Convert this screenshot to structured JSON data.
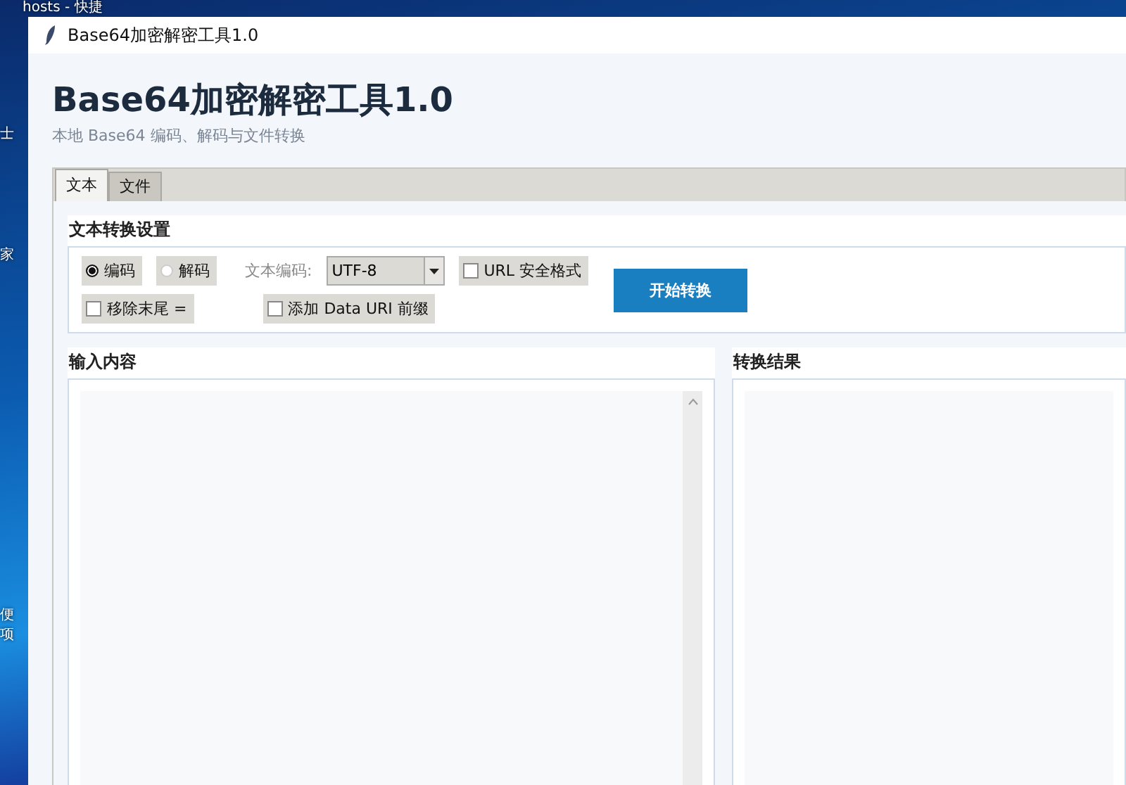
{
  "desktop": {
    "labels": [
      "hosts - 快捷",
      "士",
      "家",
      "便",
      "项"
    ]
  },
  "window": {
    "title": "Base64加密解密工具1.0"
  },
  "header": {
    "title": "Base64加密解密工具1.0",
    "subtitle": "本地 Base64 编码、解码与文件转换"
  },
  "tabs": [
    {
      "label": "文本",
      "selected": true
    },
    {
      "label": "文件",
      "selected": false
    }
  ],
  "settings": {
    "title": "文本转换设置",
    "modes": [
      {
        "label": "编码",
        "selected": true
      },
      {
        "label": "解码",
        "selected": false
      }
    ],
    "encoding_label": "文本编码:",
    "encoding": "UTF-8",
    "url_safe": {
      "label": "URL 安全格式",
      "checked": false
    },
    "strip_padding": {
      "label": "移除末尾 =",
      "checked": false
    },
    "data_uri": {
      "label": "添加 Data URI 前缀",
      "checked": false
    },
    "convert_button": "开始转换"
  },
  "input": {
    "title": "输入内容"
  },
  "output": {
    "title": "转换结果"
  }
}
